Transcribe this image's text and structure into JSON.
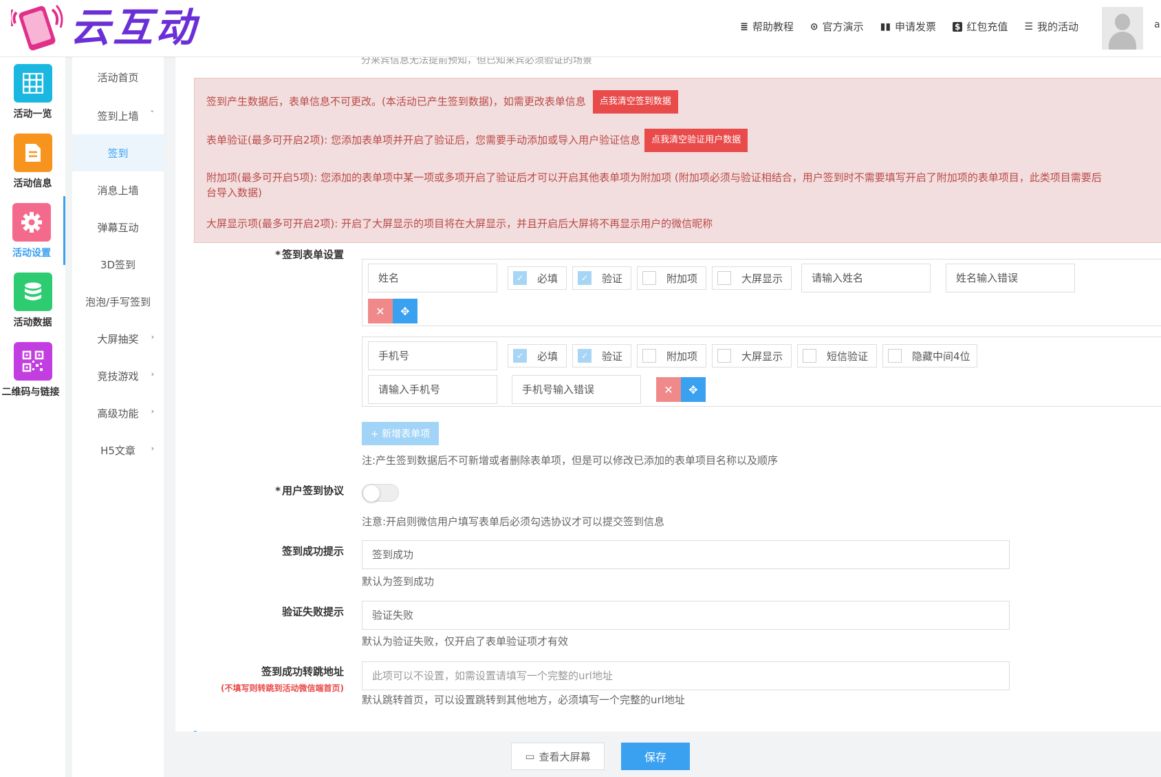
{
  "header": {
    "logo_text": "云互动",
    "nav": [
      {
        "icon": "≣",
        "label": "帮助教程"
      },
      {
        "icon": "⊙",
        "label": "官方演示"
      },
      {
        "icon": "▮▮",
        "label": "申请发票"
      },
      {
        "icon": "$",
        "label": "红包充值"
      },
      {
        "icon": "☰",
        "label": "我的活动"
      }
    ],
    "username": "a"
  },
  "iconbar": [
    {
      "label": "活动一览",
      "color": "#1ab8e0"
    },
    {
      "label": "活动信息",
      "color": "#f7941d"
    },
    {
      "label": "活动设置",
      "color": "#f46a8c"
    },
    {
      "label": "活动数据",
      "color": "#2ecc71"
    },
    {
      "label": "二维码与链接",
      "color": "#c23ee0"
    }
  ],
  "submenu": [
    {
      "label": "活动首页",
      "arrow": ""
    },
    {
      "label": "签到上墙",
      "arrow": "˅"
    },
    {
      "label": "签到",
      "arrow": ""
    },
    {
      "label": "消息上墙",
      "arrow": ""
    },
    {
      "label": "弹幕互动",
      "arrow": ""
    },
    {
      "label": "3D签到",
      "arrow": ""
    },
    {
      "label": "泡泡/手写签到",
      "arrow": ""
    },
    {
      "label": "大屏抽奖",
      "arrow": "›"
    },
    {
      "label": "竞技游戏",
      "arrow": "›"
    },
    {
      "label": "高级功能",
      "arrow": "›"
    },
    {
      "label": "H5文章",
      "arrow": "›"
    }
  ],
  "main": {
    "cut_text": "分来宾信息无法提前预知，但已知来宾必须验证的场景",
    "alert": {
      "line1": "签到产生数据后，表单信息不可更改。(本活动已产生签到数据)，如需更改表单信息",
      "btn1": "点我清空签到数据",
      "line2": "表单验证(最多可开启2项): 您添加表单项并开启了验证后，您需要手动添加或导入用户验证信息",
      "btn2": "点我清空验证用户数据",
      "line3a": "附加项(最多可开启5项): 您添加的表单项中某一项或多项开启了验证后才可以开启其他表单项为附加项 (附加项必须与验证相结合，用户签到时不需要填写开启了附加项的表单项目，此类项目需要后",
      "line3b": "台导入数据)",
      "line4": "大屏显示项(最多可开启2项): 开启了大屏显示的项目将在大屏显示，并且开启后大屏将不再显示用户的微信昵称"
    },
    "form_settings_label": "签到表单设置",
    "field1": {
      "name": "姓名",
      "required": "必填",
      "verify": "验证",
      "extra": "附加项",
      "bigscreen": "大屏显示",
      "placeholder": "请输入姓名",
      "error": "姓名输入错误"
    },
    "field2": {
      "name": "手机号",
      "required": "必填",
      "verify": "验证",
      "extra": "附加项",
      "bigscreen": "大屏显示",
      "sms": "短信验证",
      "hide4": "隐藏中间4位",
      "placeholder": "请输入手机号",
      "error": "手机号输入错误"
    },
    "add_field": "+ 新增表单项",
    "add_note": "注:产生签到数据后不可新增或者删除表单项，但是可以修改已添加的表单项目名称以及顺序",
    "agreement_label": "用户签到协议",
    "agreement_note": "注意:开启则微信用户填写表单后必须勾选协议才可以提交签到信息",
    "success_label": "签到成功提示",
    "success_value": "签到成功",
    "success_note": "默认为签到成功",
    "fail_label": "验证失败提示",
    "fail_value": "验证失败",
    "fail_note": "默认为验证失败，仅开启了表单验证项才有效",
    "redirect_label": "签到成功转跳地址",
    "redirect_sub": "(不填写则转跳到活动微信端首页)",
    "redirect_placeholder": "此项可以不设置，如需设置请填写一个完整的url地址",
    "redirect_note": "默认跳转首页，可以设置跳转到其他地方，必须填写一个完整的url地址"
  },
  "footer": {
    "view_label": "查看大屏幕",
    "save_label": "保存"
  }
}
